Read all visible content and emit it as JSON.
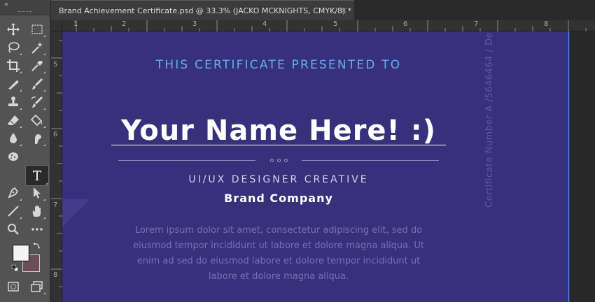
{
  "toolbar": {
    "collapse_label": "«",
    "tools": [
      {
        "name": "move-tool",
        "icon": "move-icon"
      },
      {
        "name": "marquee-tool",
        "icon": "rect-marquee-icon"
      },
      {
        "name": "lasso-tool",
        "icon": "lasso-icon"
      },
      {
        "name": "magic-wand-tool",
        "icon": "magic-wand-icon"
      },
      {
        "name": "crop-tool",
        "icon": "crop-icon"
      },
      {
        "name": "eyedropper-tool",
        "icon": "eyedropper-icon"
      },
      {
        "name": "healing-brush-tool",
        "icon": "bandage-icon"
      },
      {
        "name": "brush-tool",
        "icon": "brush-icon"
      },
      {
        "name": "clone-stamp-tool",
        "icon": "stamp-icon"
      },
      {
        "name": "history-brush-tool",
        "icon": "history-brush-icon"
      },
      {
        "name": "eraser-tool",
        "icon": "eraser-icon"
      },
      {
        "name": "paint-bucket-tool",
        "icon": "bucket-icon"
      },
      {
        "name": "blur-tool",
        "icon": "drop-icon"
      },
      {
        "name": "smudge-tool",
        "icon": "smudge-icon"
      },
      {
        "name": "sponge-tool",
        "icon": "sponge-icon"
      },
      {
        "name": "type-tool",
        "icon": "type-icon",
        "active": true
      },
      {
        "name": "pen-tool",
        "icon": "pen-icon"
      },
      {
        "name": "path-selection-tool",
        "icon": "arrow-icon"
      },
      {
        "name": "line-tool",
        "icon": "line-icon"
      },
      {
        "name": "hand-tool",
        "icon": "hand-icon"
      },
      {
        "name": "zoom-tool",
        "icon": "zoom-icon"
      },
      {
        "name": "more-tools",
        "icon": "ellipsis-icon"
      }
    ],
    "foreground_color": "#f4f4f4",
    "background_color": "#6d4e57"
  },
  "document": {
    "tab_title": "Brand Achievement Certificate.psd @ 33.3% (JACKO MCKNIGHTS, CMYK/8) *",
    "close_glyph": "×"
  },
  "rulers": {
    "horizontal": [
      "1",
      "2",
      "3",
      "4",
      "5",
      "6",
      "7",
      "8"
    ],
    "vertical": [
      "5",
      "6",
      "7",
      "8"
    ]
  },
  "certificate": {
    "background": "#38307a",
    "presented_to": "THIS CERTIFICATE PRESENTED TO",
    "recipient_name": "Your Name Here! :)",
    "role": "UI/UX DESIGNER CREATIVE",
    "company": "Brand Company",
    "body_lines": [
      "Lorem ipsum dolor sit amet, consectetur adipiscing elit, sed do",
      "eiusmod tempor incididunt ut labore et dolore magna aliqua. Ut",
      "enim ad sed do eiusmod labore et dolore  tempor incididunt ut",
      "labore et dolore magna aliqua."
    ],
    "certificate_number": "Certificate Number A /5646464 / De",
    "accent_color": "#5fb0f0",
    "guide_color": "#3aa0ff"
  }
}
